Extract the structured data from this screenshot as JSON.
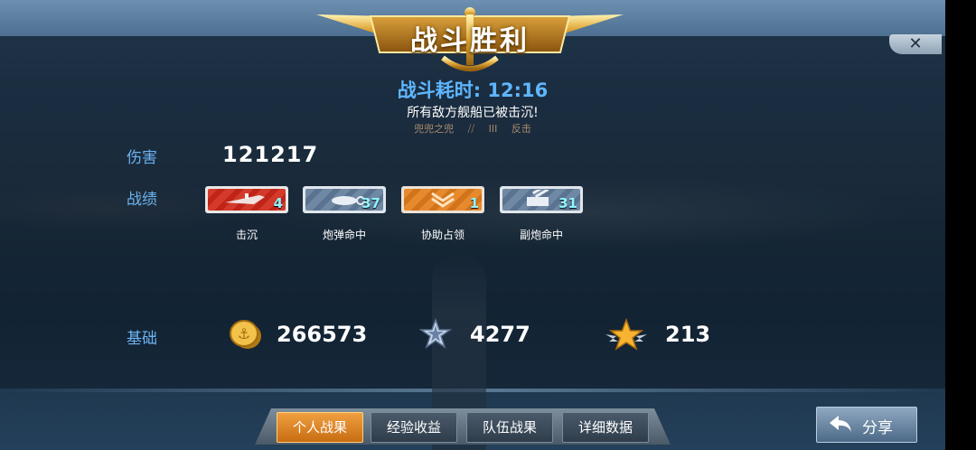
{
  "header": {
    "title": "战斗胜利",
    "close_icon": "close-icon"
  },
  "summary": {
    "time_label": "战斗耗时: 12:16",
    "result_text": "所有敌方舰船已被击沉!",
    "player_name": "兜兜之兜",
    "rank_text": "III",
    "ship_name": "反击"
  },
  "stats": {
    "damage_label": "伤害",
    "damage_value": "121217",
    "record_label": "战绩",
    "medals": [
      {
        "icon": "sink-ship-icon",
        "count": "4",
        "label": "击沉",
        "color": "#d43a2a"
      },
      {
        "icon": "shell-hit-icon",
        "count": "37",
        "label": "炮弹命中",
        "color": "#6f88a3"
      },
      {
        "icon": "capture-assist-icon",
        "count": "1",
        "label": "协助占领",
        "color": "#e78a2e"
      },
      {
        "icon": "secondary-gun-icon",
        "count": "31",
        "label": "副炮命中",
        "color": "#6f88a3"
      }
    ],
    "base_label": "基础",
    "rewards": [
      {
        "icon": "gold-coin-icon",
        "value": "266573"
      },
      {
        "icon": "silver-star-icon",
        "value": "4277"
      },
      {
        "icon": "gold-star-icon",
        "value": "213"
      }
    ]
  },
  "tabs": [
    "个人战果",
    "经验收益",
    "队伍战果",
    "详细数据"
  ],
  "share_label": "分享",
  "colors": {
    "accent_blue": "#6bb3f0",
    "tab_active": "#e78a2e"
  }
}
